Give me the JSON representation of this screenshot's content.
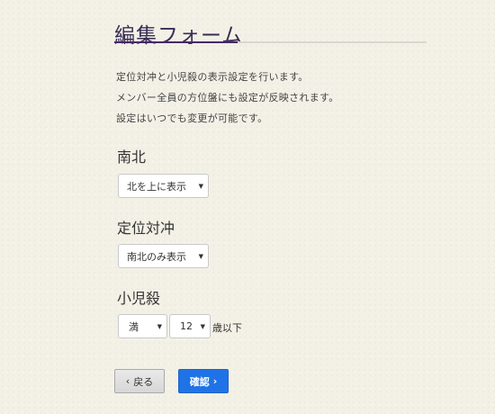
{
  "title": "編集フォーム",
  "description": [
    "定位対冲と小児殺の表示設定を行います。",
    "メンバー全員の方位盤にも設定が反映されます。",
    "設定はいつでも変更が可能です。"
  ],
  "sections": {
    "north_south": {
      "label": "南北",
      "selected": "北を上に表示"
    },
    "teii_taichu": {
      "label": "定位対冲",
      "selected": "南北のみ表示"
    },
    "shoujisatsu": {
      "label": "小児殺",
      "age_type_selected": "満",
      "age_value_selected": "12",
      "age_suffix": "歳以下"
    }
  },
  "buttons": {
    "back_label": "戻る",
    "back_icon": "chevron-left-icon",
    "confirm_label": "確認",
    "confirm_icon": "chevron-right-icon"
  },
  "colors": {
    "background": "#f3f1e6",
    "title": "#3a2c56",
    "title_accent": "#472a66",
    "confirm_button": "#1f73e6"
  }
}
